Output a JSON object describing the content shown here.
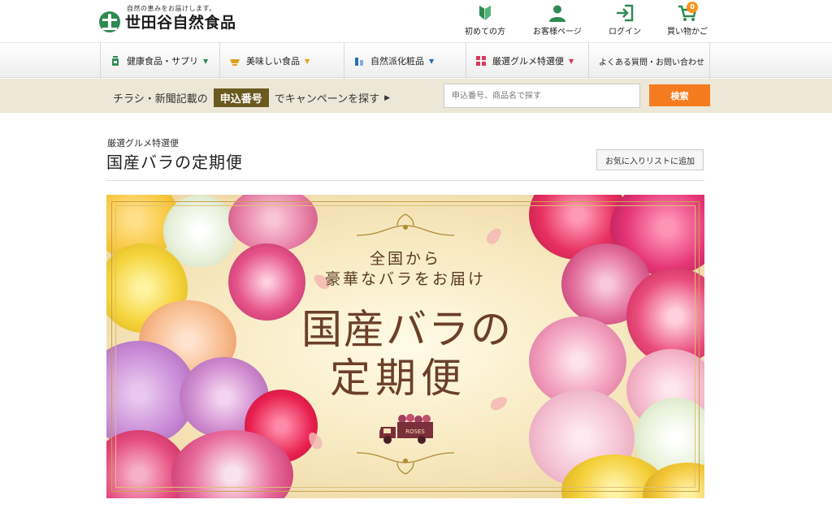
{
  "header": {
    "tagline": "自然の恵みをお届けします。",
    "brand": "世田谷自然食品",
    "nav": [
      {
        "label": "初めての方",
        "icon": "beginner-mark-icon"
      },
      {
        "label": "お客様ページ",
        "icon": "user-icon"
      },
      {
        "label": "ログイン",
        "icon": "login-icon"
      },
      {
        "label": "買い物かご",
        "icon": "shopping-cart-icon",
        "badge": "0"
      }
    ]
  },
  "categories": [
    {
      "label": "健康食品・サプリ",
      "icon": "supplement-bottle-icon",
      "caret_color": "#2f8a52"
    },
    {
      "label": "美味しい食品",
      "icon": "food-bowl-icon",
      "caret_color": "#e0a020"
    },
    {
      "label": "自然派化粧品",
      "icon": "cosmetics-icon",
      "caret_color": "#2a6fb5"
    },
    {
      "label": "厳選グルメ特選便",
      "icon": "gift-box-icon",
      "caret_color": "#d83a5a"
    },
    {
      "label": "よくある質問・お問い合わせ"
    }
  ],
  "campaign": {
    "prefix": "チラシ・新聞記載の",
    "badge": "申込番号",
    "suffix": "でキャンペーンを探す",
    "search_placeholder": "申込番号、商品名で探す",
    "search_button": "検索"
  },
  "page": {
    "breadcrumb": "厳選グルメ特選便",
    "title": "国産バラの定期便",
    "favorite_button": "お気に入りリストに追加"
  },
  "banner": {
    "lead_line1": "全国から",
    "lead_line2": "豪華なバラをお届け",
    "title_line1": "国産バラの",
    "title_line2": "定期便",
    "truck_label": "ROSES"
  },
  "colors": {
    "brand_green": "#2f8a52",
    "accent_orange": "#f47c1f",
    "campaign_bar": "#ece7d6",
    "badge_brown": "#6b5a20"
  }
}
